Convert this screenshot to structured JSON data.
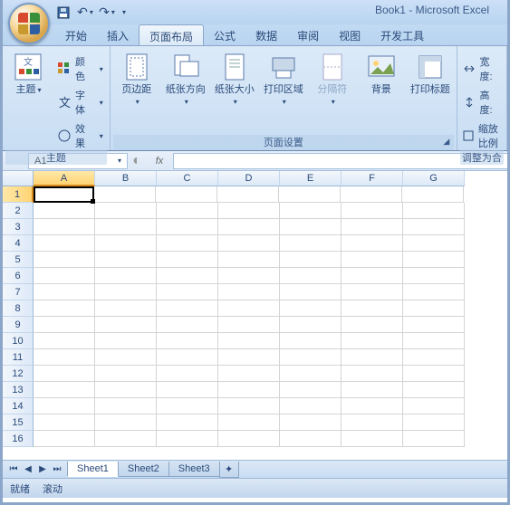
{
  "title": "Book1 - Microsoft Excel",
  "qat": {
    "save": "💾",
    "undo": "↶",
    "redo": "↷"
  },
  "tabs": [
    "开始",
    "插入",
    "页面布局",
    "公式",
    "数据",
    "审阅",
    "视图",
    "开发工具"
  ],
  "active_tab_index": 2,
  "ribbon": {
    "theme_group": {
      "label": "主题",
      "theme_btn": "主题",
      "colors": "颜色",
      "fonts": "字体",
      "effects": "效果"
    },
    "page_setup_group": {
      "label": "页面设置",
      "margins": "页边距",
      "orientation": "纸张方向",
      "size": "纸张大小",
      "print_area": "打印区域",
      "breaks": "分隔符",
      "background": "背景",
      "print_titles": "打印标题"
    },
    "scale_group": {
      "label": "调整为合",
      "width": "宽度:",
      "height": "高度:",
      "scale": "缩放比例"
    }
  },
  "namebox": {
    "value": "A1",
    "fx": "fx"
  },
  "columns": [
    "A",
    "B",
    "C",
    "D",
    "E",
    "F",
    "G"
  ],
  "rows": [
    1,
    2,
    3,
    4,
    5,
    6,
    7,
    8,
    9,
    10,
    11,
    12,
    13,
    14,
    15,
    16
  ],
  "active_cell": {
    "row": 0,
    "col": 0
  },
  "sheets": [
    "Sheet1",
    "Sheet2",
    "Sheet3"
  ],
  "active_sheet": 0,
  "status": {
    "ready": "就绪",
    "scroll": "滚动"
  }
}
